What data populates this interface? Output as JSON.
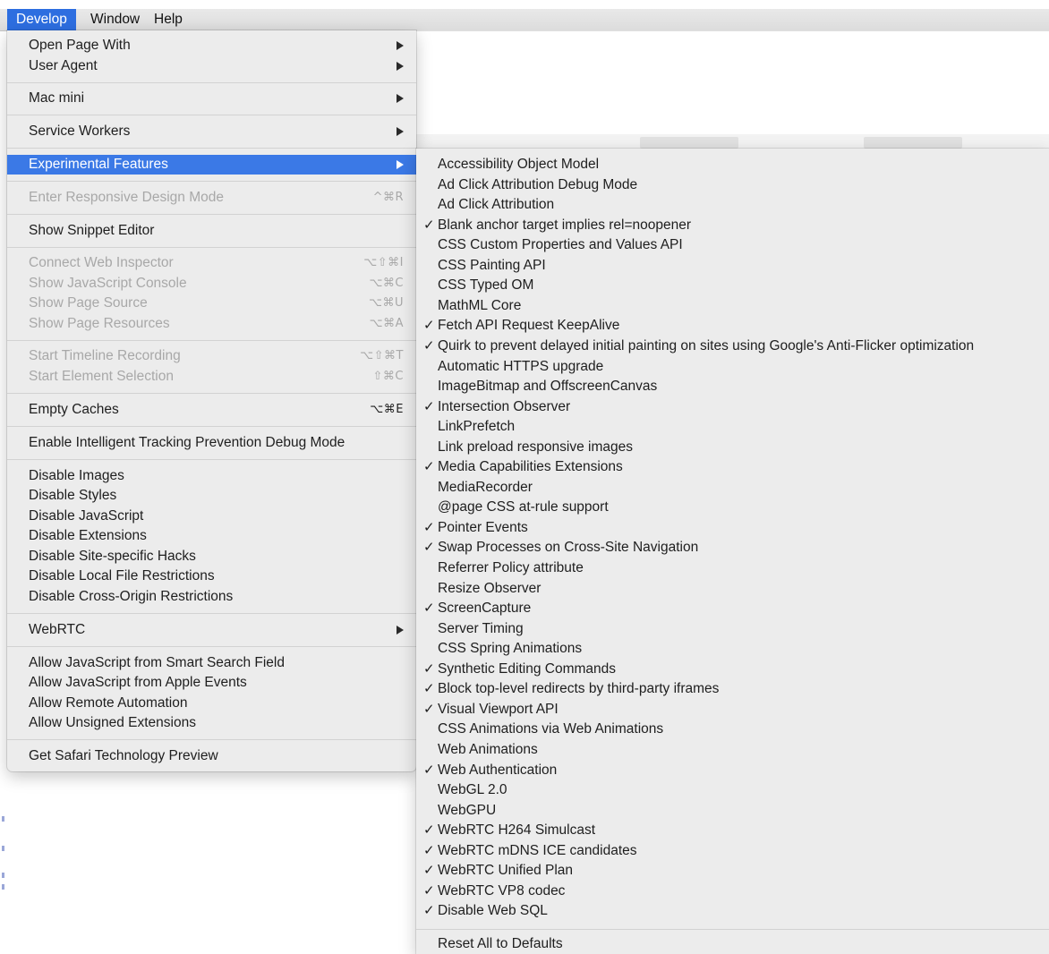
{
  "menubar": {
    "items": [
      "Develop",
      "Window",
      "Help"
    ]
  },
  "develop_menu": {
    "open_page_with": "Open Page With",
    "user_agent": "User Agent",
    "mac_mini": "Mac mini",
    "service_workers": "Service Workers",
    "experimental_features": "Experimental Features",
    "enter_responsive": {
      "label": "Enter Responsive Design Mode",
      "shortcut": "^⌘R"
    },
    "show_snippet_editor": "Show Snippet Editor",
    "connect_web_inspector": {
      "label": "Connect Web Inspector",
      "shortcut": "⌥⇧⌘I"
    },
    "show_js_console": {
      "label": "Show JavaScript Console",
      "shortcut": "⌥⌘C"
    },
    "show_page_source": {
      "label": "Show Page Source",
      "shortcut": "⌥⌘U"
    },
    "show_page_resources": {
      "label": "Show Page Resources",
      "shortcut": "⌥⌘A"
    },
    "start_timeline": {
      "label": "Start Timeline Recording",
      "shortcut": "⌥⇧⌘T"
    },
    "start_element_selection": {
      "label": "Start Element Selection",
      "shortcut": "⇧⌘C"
    },
    "empty_caches": {
      "label": "Empty Caches",
      "shortcut": "⌥⌘E"
    },
    "enable_itp_debug": "Enable Intelligent Tracking Prevention Debug Mode",
    "disable_images": "Disable Images",
    "disable_styles": "Disable Styles",
    "disable_javascript": "Disable JavaScript",
    "disable_extensions": "Disable Extensions",
    "disable_site_hacks": "Disable Site-specific Hacks",
    "disable_local_file": "Disable Local File Restrictions",
    "disable_cross_origin": "Disable Cross-Origin Restrictions",
    "webrtc": "WebRTC",
    "allow_js_smart_search": "Allow JavaScript from Smart Search Field",
    "allow_js_apple_events": "Allow JavaScript from Apple Events",
    "allow_remote_automation": "Allow Remote Automation",
    "allow_unsigned_extensions": "Allow Unsigned Extensions",
    "get_safari_tp": "Get Safari Technology Preview"
  },
  "experimental_menu": {
    "check_glyph": "✓",
    "features": [
      {
        "label": "Accessibility Object Model",
        "checked": false
      },
      {
        "label": "Ad Click Attribution Debug Mode",
        "checked": false
      },
      {
        "label": "Ad Click Attribution",
        "checked": false
      },
      {
        "label": "Blank anchor target implies rel=noopener",
        "checked": true
      },
      {
        "label": "CSS Custom Properties and Values API",
        "checked": false
      },
      {
        "label": "CSS Painting API",
        "checked": false
      },
      {
        "label": "CSS Typed OM",
        "checked": false
      },
      {
        "label": "MathML Core",
        "checked": false
      },
      {
        "label": "Fetch API Request KeepAlive",
        "checked": true
      },
      {
        "label": "Quirk to prevent delayed initial painting on sites using Google's Anti-Flicker optimization",
        "checked": true
      },
      {
        "label": "Automatic HTTPS upgrade",
        "checked": false
      },
      {
        "label": "ImageBitmap and OffscreenCanvas",
        "checked": false
      },
      {
        "label": "Intersection Observer",
        "checked": true
      },
      {
        "label": "LinkPrefetch",
        "checked": false
      },
      {
        "label": "Link preload responsive images",
        "checked": false
      },
      {
        "label": "Media Capabilities Extensions",
        "checked": true
      },
      {
        "label": "MediaRecorder",
        "checked": false
      },
      {
        "label": "@page CSS at-rule support",
        "checked": false
      },
      {
        "label": "Pointer Events",
        "checked": true
      },
      {
        "label": "Swap Processes on Cross-Site Navigation",
        "checked": true
      },
      {
        "label": "Referrer Policy attribute",
        "checked": false
      },
      {
        "label": "Resize Observer",
        "checked": false
      },
      {
        "label": "ScreenCapture",
        "checked": true
      },
      {
        "label": "Server Timing",
        "checked": false
      },
      {
        "label": "CSS Spring Animations",
        "checked": false
      },
      {
        "label": "Synthetic Editing Commands",
        "checked": true
      },
      {
        "label": "Block top-level redirects by third-party iframes",
        "checked": true
      },
      {
        "label": "Visual Viewport API",
        "checked": true
      },
      {
        "label": "CSS Animations via Web Animations",
        "checked": false
      },
      {
        "label": "Web Animations",
        "checked": false
      },
      {
        "label": "Web Authentication",
        "checked": true
      },
      {
        "label": "WebGL 2.0",
        "checked": false
      },
      {
        "label": "WebGPU",
        "checked": false
      },
      {
        "label": "WebRTC H264 Simulcast",
        "checked": true
      },
      {
        "label": "WebRTC mDNS ICE candidates",
        "checked": true
      },
      {
        "label": "WebRTC Unified Plan",
        "checked": true
      },
      {
        "label": "WebRTC VP8 codec",
        "checked": true
      },
      {
        "label": "Disable Web SQL",
        "checked": true
      }
    ],
    "reset_all": "Reset All to Defaults"
  }
}
